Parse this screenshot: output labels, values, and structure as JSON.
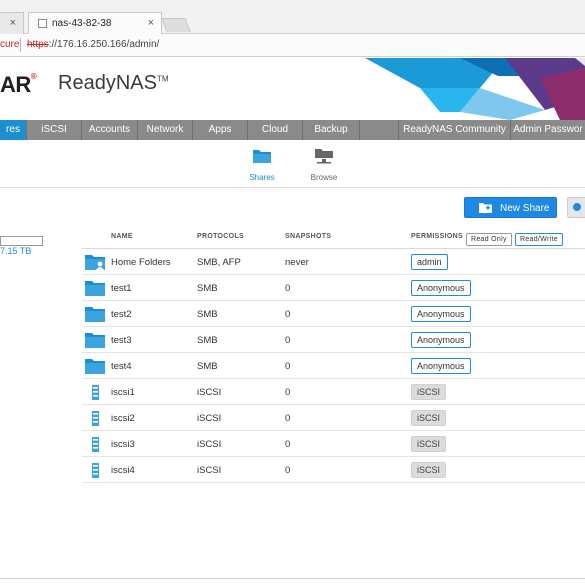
{
  "browser": {
    "tab_title": "nas-43-82-38",
    "close_glyph": "×",
    "address": {
      "secure_text": "cure",
      "url_scheme": "https",
      "url_rest": "://176.16.250.166/admin/"
    }
  },
  "brand": {
    "logo_fragment": "AR",
    "product": "ReadyNAS",
    "tm": "TM"
  },
  "nav": [
    {
      "label": "res",
      "active": true
    },
    {
      "label": "iSCSI"
    },
    {
      "label": "Accounts"
    },
    {
      "label": "Network"
    },
    {
      "label": "Apps"
    },
    {
      "label": "Cloud"
    },
    {
      "label": "Backup"
    },
    {
      "label": ""
    },
    {
      "label": "ReadyNAS Community"
    },
    {
      "label": "Admin Passwor"
    }
  ],
  "subnav": {
    "shares": "Shares",
    "browse": "Browse"
  },
  "actions": {
    "new_share": "New Share"
  },
  "capacity": {
    "text": "7.15 TB"
  },
  "table": {
    "headers": {
      "name": "NAME",
      "protocols": "PROTOCOLS",
      "snapshots": "SNAPSHOTS",
      "permissions": "PERMISSIONS"
    },
    "perm_buttons": {
      "read_only": "Read Only",
      "read_write": "Read/Write"
    },
    "rows": [
      {
        "name": "Home Folders",
        "protocols": "SMB, AFP",
        "snapshots": "never",
        "permission": "admin",
        "kind": "home"
      },
      {
        "name": "test1",
        "protocols": "SMB",
        "snapshots": "0",
        "permission": "Anonymous",
        "kind": "folder"
      },
      {
        "name": "test2",
        "protocols": "SMB",
        "snapshots": "0",
        "permission": "Anonymous",
        "kind": "folder"
      },
      {
        "name": "test3",
        "protocols": "SMB",
        "snapshots": "0",
        "permission": "Anonymous",
        "kind": "folder"
      },
      {
        "name": "test4",
        "protocols": "SMB",
        "snapshots": "0",
        "permission": "Anonymous",
        "kind": "folder"
      },
      {
        "name": "iscsi1",
        "protocols": "iSCSI",
        "snapshots": "0",
        "permission": "iSCSI",
        "kind": "lun"
      },
      {
        "name": "iscsi2",
        "protocols": "iSCSI",
        "snapshots": "0",
        "permission": "iSCSI",
        "kind": "lun"
      },
      {
        "name": "iscsi3",
        "protocols": "iSCSI",
        "snapshots": "0",
        "permission": "iSCSI",
        "kind": "lun"
      },
      {
        "name": "iscsi4",
        "protocols": "iSCSI",
        "snapshots": "0",
        "permission": "iSCSI",
        "kind": "lun"
      }
    ]
  },
  "colors": {
    "accent": "#1c8fd1",
    "nav_bg": "#8a8a8a",
    "button_blue": "#1e88e5",
    "insecure_red": "#c62828"
  }
}
